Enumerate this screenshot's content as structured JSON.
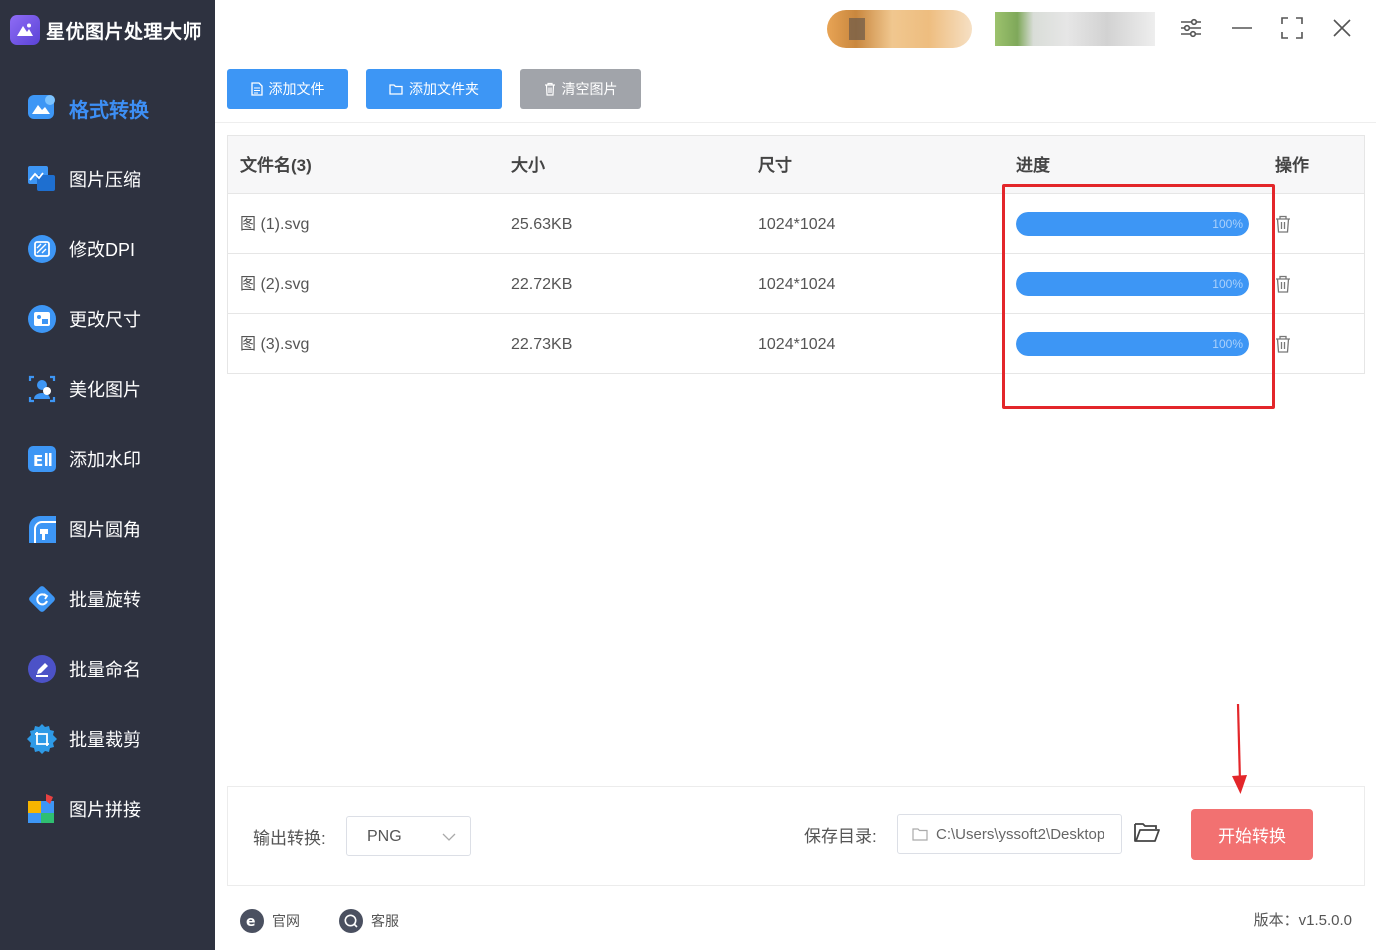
{
  "app": {
    "title": "星优图片处理大师"
  },
  "sidebar": {
    "items": [
      {
        "label": "格式转换",
        "icon": "format-convert-icon",
        "active": true
      },
      {
        "label": "图片压缩",
        "icon": "compress-icon"
      },
      {
        "label": "修改DPI",
        "icon": "dpi-icon"
      },
      {
        "label": "更改尺寸",
        "icon": "resize-icon"
      },
      {
        "label": "美化图片",
        "icon": "beautify-icon"
      },
      {
        "label": "添加水印",
        "icon": "watermark-icon"
      },
      {
        "label": "图片圆角",
        "icon": "rounded-corner-icon"
      },
      {
        "label": "批量旋转",
        "icon": "rotate-icon"
      },
      {
        "label": "批量命名",
        "icon": "rename-icon"
      },
      {
        "label": "批量裁剪",
        "icon": "crop-icon"
      },
      {
        "label": "图片拼接",
        "icon": "stitch-icon"
      }
    ]
  },
  "toolbar": {
    "add_file": "添加文件",
    "add_folder": "添加文件夹",
    "clear": "清空图片"
  },
  "table": {
    "headers": {
      "name": "文件名(3)",
      "size": "大小",
      "dimensions": "尺寸",
      "progress": "进度",
      "action": "操作"
    },
    "rows": [
      {
        "name": "图 (1).svg",
        "size": "25.63KB",
        "dimensions": "1024*1024",
        "progress": 1.0,
        "progress_label": "100%"
      },
      {
        "name": "图 (2).svg",
        "size": "22.72KB",
        "dimensions": "1024*1024",
        "progress": 1.0,
        "progress_label": "100%"
      },
      {
        "name": "图 (3).svg",
        "size": "22.73KB",
        "dimensions": "1024*1024",
        "progress": 1.0,
        "progress_label": "100%"
      }
    ]
  },
  "output": {
    "format_label": "输出转换:",
    "format_value": "PNG",
    "save_dir_label": "保存目录:",
    "save_dir_value": "C:\\Users\\yssoft2\\Desktop",
    "start_button": "开始转换"
  },
  "footer": {
    "website": "官网",
    "support": "客服",
    "version": "版本：v1.5.0.0"
  },
  "colors": {
    "sidebar_bg": "#2e3240",
    "accent": "#3d96f5",
    "start_button": "#f27171",
    "highlight": "#e3262a"
  }
}
